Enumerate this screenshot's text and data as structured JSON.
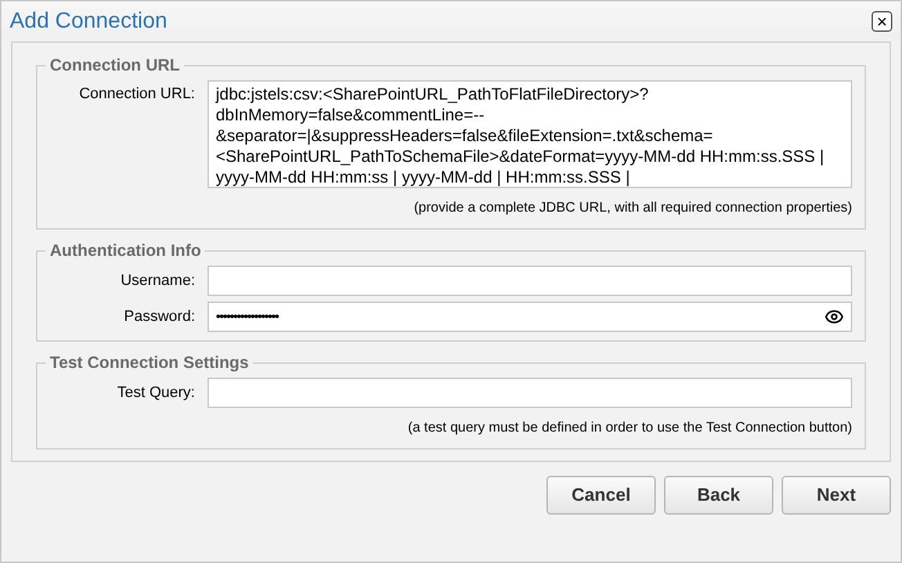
{
  "window": {
    "title": "Add Connection",
    "close": "×"
  },
  "sections": [
    {
      "legend": "Connection URL",
      "fields": [
        {
          "kind": "multiline",
          "label": "Connection URL:",
          "lines": [
            "jdbc:jstels:csv:<SharePointURL_PathToFlatFileDirectory>?",
            "dbInMemory=false&commentLine=--",
            "&separator=|&suppressHeaders=false&fileExtension=.txt&schema=",
            "<SharePointURL_PathToSchemaFile>&dateFormat=yyyy-MM-dd HH:mm:ss.SSS |",
            "yyyy-MM-dd HH:mm:ss | yyyy-MM-dd | HH:mm:ss.SSS |"
          ]
        }
      ],
      "hint": "(provide a complete JDBC URL, with all required connection properties)"
    },
    {
      "legend": "Authentication Info",
      "fields": [
        {
          "kind": "text",
          "label": "Username:"
        },
        {
          "kind": "password",
          "label": "Password:",
          "value": "••••••••••••••••••"
        }
      ]
    },
    {
      "legend": "Test Connection Settings",
      "fields": [
        {
          "kind": "text",
          "label": "Test Query:"
        }
      ],
      "hint": "(a test query must be defined in order to use the Test Connection button)"
    }
  ],
  "buttons": [
    "Cancel",
    "Back",
    "Next"
  ]
}
